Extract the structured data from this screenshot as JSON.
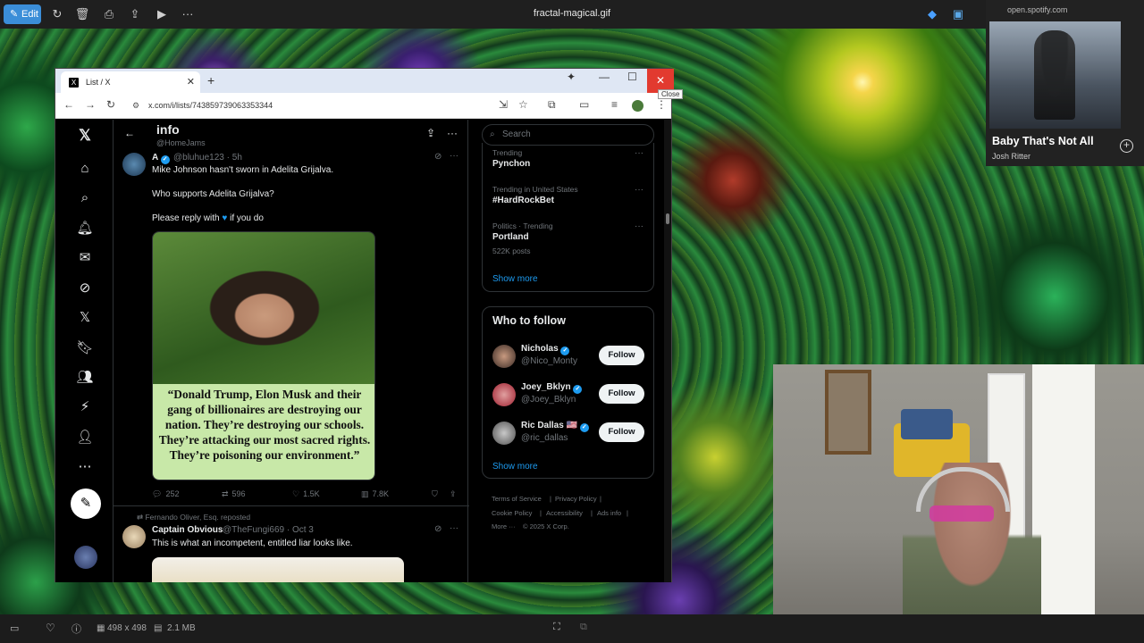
{
  "viewer": {
    "edit_label": "Edit",
    "file_title": "fractal-magical.gif",
    "dimensions": "498 x 498",
    "file_size": "2.1 MB"
  },
  "spotify": {
    "url": "open.spotify.com",
    "song": "Baby That's Not All",
    "artist": "Josh Ritter"
  },
  "browser": {
    "tab_title": "List / X",
    "url": "x.com/i/lists/743859739063353344",
    "close_tooltip": "Close"
  },
  "list": {
    "name": "info",
    "handle": "@HomeJams"
  },
  "post1": {
    "name": "A",
    "handle": "@bluhue123 · 5h",
    "line1": "Mike Johnson hasn't sworn in Adelita Grijalva.",
    "line2": "Who supports Adelita Grijalva?",
    "line3a": "Please reply with",
    "line3b": "if you do",
    "quote": "“Donald Trump, Elon Musk and their gang of billionaires are destroying our nation. They’re destroying our schools. They’re attacking our most sacred rights. They’re poisoning our environment.”",
    "replies": "252",
    "reposts": "596",
    "likes": "1.5K",
    "views": "7.8K"
  },
  "post2": {
    "repost_by": "Fernando Oliver, Esq. reposted",
    "name": "Captain Obvious",
    "handle": "@TheFungi669 · Oct 3",
    "text": "This is what an incompetent, entitled liar looks like."
  },
  "right": {
    "search_placeholder": "Search",
    "trends": [
      {
        "sub": "Trending",
        "name": "Pynchon"
      },
      {
        "sub": "Trending in United States",
        "name": "#HardRockBet"
      },
      {
        "sub": "Politics · Trending",
        "name": "Portland",
        "posts": "522K posts"
      }
    ],
    "show_more": "Show more",
    "who_to_follow": "Who to follow",
    "follow_label": "Follow",
    "suggestions": [
      {
        "name": "Nicholas",
        "handle": "@Nico_Monty"
      },
      {
        "name": "Joey_Bklyn",
        "handle": "@Joey_Bklyn"
      },
      {
        "name": "Ric Dallas 🇺🇸",
        "handle": "@ric_dallas"
      }
    ],
    "footer": {
      "terms": "Terms of Service",
      "privacy": "Privacy Policy",
      "cookie": "Cookie Policy",
      "access": "Accessibility",
      "ads": "Ads info",
      "more": "More ···",
      "copy": "© 2025 X Corp."
    }
  },
  "colors": {
    "accent": "#1d9bf0",
    "close_red": "#e23a2f",
    "edit_blue": "#3b8ed8"
  }
}
